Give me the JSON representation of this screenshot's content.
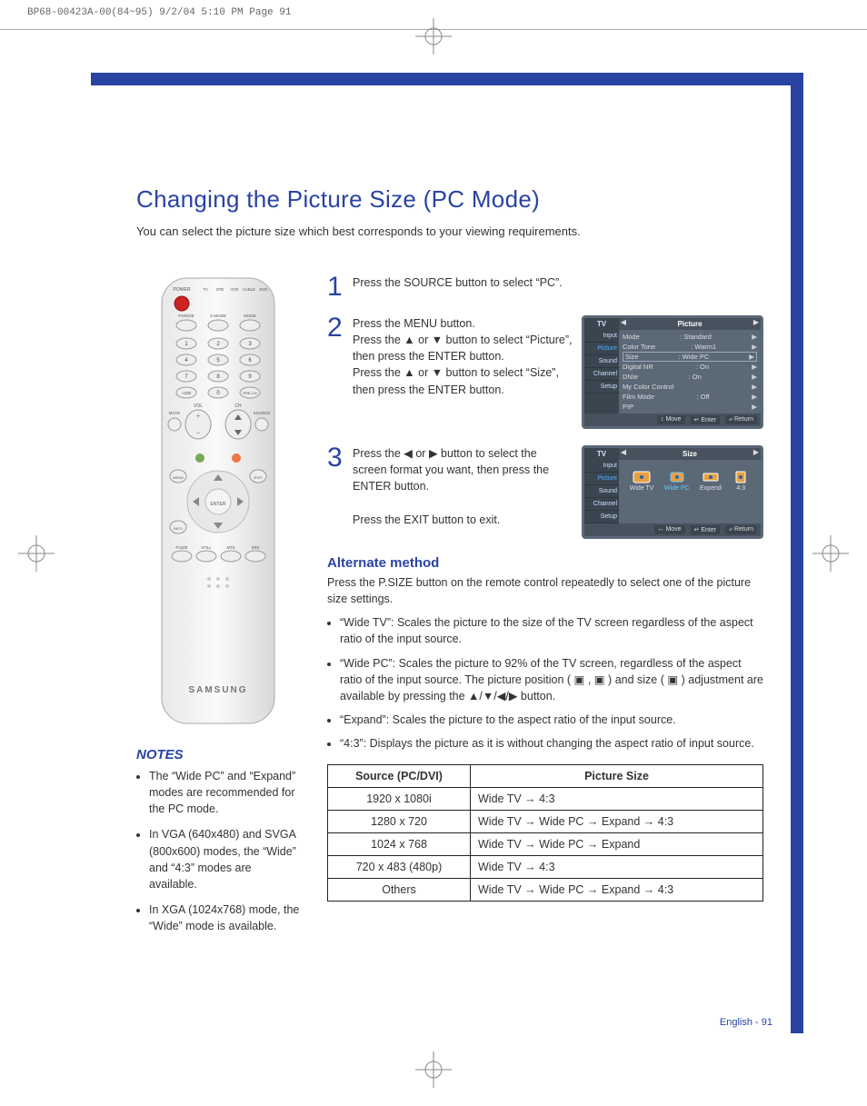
{
  "print_header": "BP68-00423A-00(84~95)  9/2/04  5:10 PM  Page 91",
  "title": "Changing the Picture Size (PC Mode)",
  "intro": "You can select the picture size which best corresponds to your viewing requirements.",
  "remote_brand": "SAMSUNG",
  "remote_labels": {
    "power": "POWER",
    "tv": "TV",
    "stb": "STB",
    "vcr": "VCR",
    "cable": "CABLE",
    "dvd": "DVD",
    "pmode": "P.MODE",
    "smode": "S.MODE",
    "mode": "MODE",
    "plus100": "+100",
    "prech": "PRE-CH",
    "vol": "VOL",
    "ch": "CH",
    "mute": "MUTE",
    "source": "SOURCE",
    "menu": "MENU",
    "exit": "EXIT",
    "enter": "ENTER",
    "info": "INFO",
    "psize": "P.SIZE",
    "still": "STILL",
    "mts": "MTS",
    "srs": "SRS"
  },
  "notes_head": "NOTES",
  "notes": [
    "The “Wide PC” and “Expand” modes are recommended for the PC mode.",
    "In VGA (640x480) and SVGA (800x600) modes, the “Wide” and “4:3” modes are available.",
    "In XGA (1024x768) mode, the “Wide” mode is available."
  ],
  "steps": {
    "s1": "Press the SOURCE button to select “PC”.",
    "s2a": "Press the MENU button.",
    "s2b": "Press the ▲ or ▼ button to select “Picture”, then press the ENTER button.",
    "s2c": "Press the ▲ or ▼ button to select “Size”, then press the ENTER button.",
    "s3a": "Press the ◀ or ▶ button to select the screen format you want, then press the ENTER button.",
    "s3b": "Press the EXIT button to exit."
  },
  "osd": {
    "tv": "TV",
    "picture_title": "Picture",
    "size_title": "Size",
    "side": [
      "Input",
      "Picture",
      "Sound",
      "Channel",
      "Setup"
    ],
    "rows": [
      {
        "k": "Mode",
        "v": ": Standard"
      },
      {
        "k": "Color Tone",
        "v": ": Warm1"
      },
      {
        "k": "Size",
        "v": ": Wide PC"
      },
      {
        "k": "Digital NR",
        "v": ": On"
      },
      {
        "k": "DNIe",
        "v": ": On"
      },
      {
        "k": "My Color Control",
        "v": ""
      },
      {
        "k": "Film Mode",
        "v": ": Off"
      },
      {
        "k": "PIP",
        "v": ""
      }
    ],
    "foot_move_ud": "↕ Move",
    "foot_move_lr": "↔ Move",
    "foot_enter": "↵ Enter",
    "foot_return": "⤶ Return",
    "size_opts": [
      "Wide TV",
      "Wide PC",
      "Expend",
      "4:3"
    ]
  },
  "alt_head": "Alternate method",
  "alt_text": "Press the P.SIZE button on the remote control repeatedly to select one of the picture size settings.",
  "alt_list": [
    "“Wide TV”: Scales the picture to the size of the TV screen regardless of the aspect ratio of the input source.",
    "“Wide PC”: Scales the picture to 92% of the TV screen, regardless of the aspect ratio of the input source. The picture position ( ▣ , ▣ ) and size ( ▣ ) adjustment are available by pressing the ▲/▼/◀/▶ button.",
    "“Expand”: Scales the picture to the aspect ratio of the input source.",
    "“4:3”: Displays the picture as it is without changing the aspect ratio of input source."
  ],
  "table": {
    "h1": "Source (PC/DVI)",
    "h2": "Picture Size",
    "rows": [
      {
        "src": "1920 x 1080i",
        "size": "Wide TV → 4:3"
      },
      {
        "src": "1280 x 720",
        "size": "Wide TV → Wide PC → Expand → 4:3"
      },
      {
        "src": "1024 x 768",
        "size": "Wide TV → Wide PC → Expand"
      },
      {
        "src": "720 x 483 (480p)",
        "size": "Wide TV → 4:3"
      },
      {
        "src": "Others",
        "size": "Wide TV → Wide PC → Expand → 4:3"
      }
    ]
  },
  "page_num": "English - 91"
}
